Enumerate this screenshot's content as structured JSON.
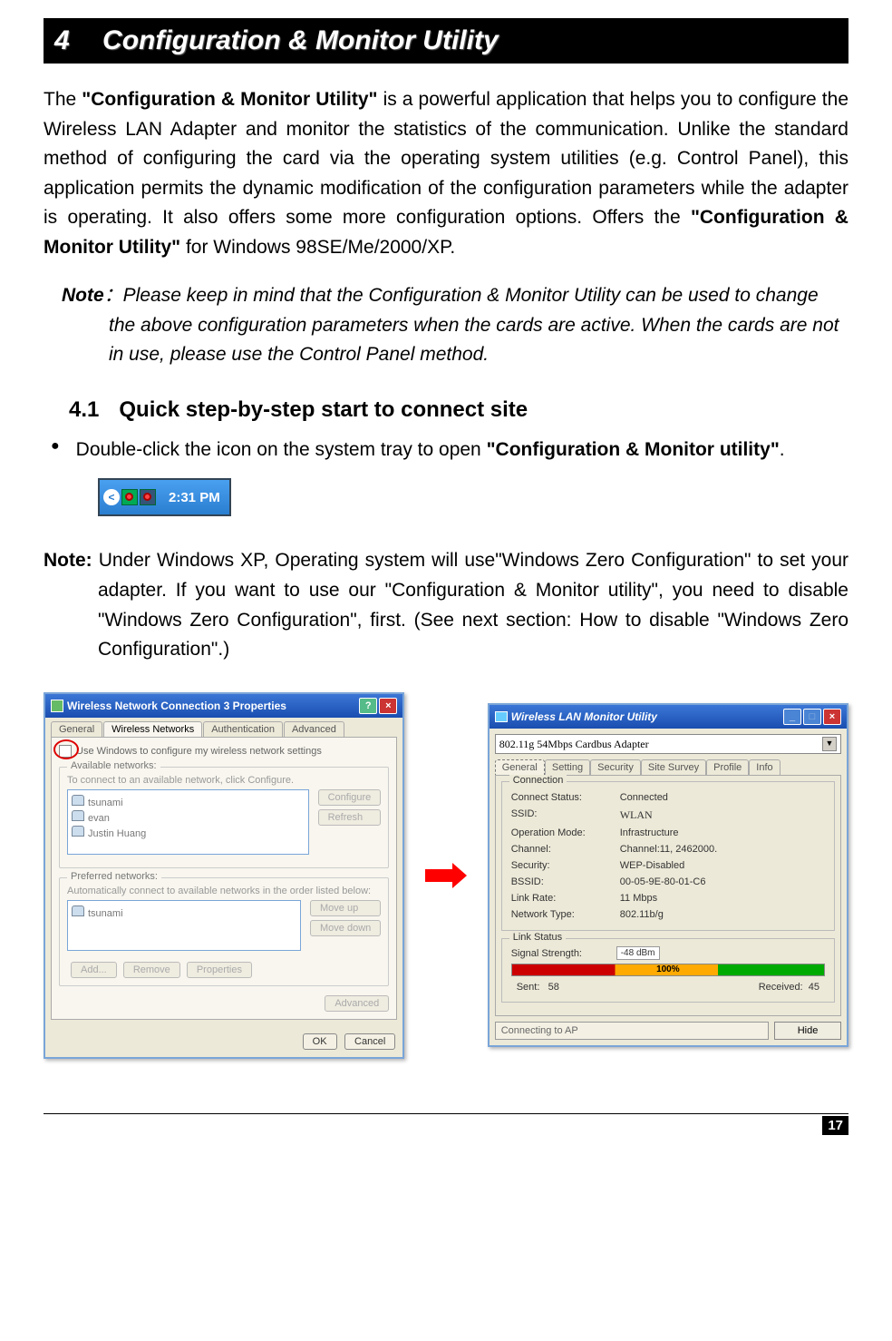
{
  "title": {
    "num": "4",
    "text": "Configuration & Monitor Utility"
  },
  "intro": {
    "pre": "The ",
    "b1": "\"Configuration & Monitor Utility\"",
    "mid1": " is a powerful application that helps you to configure the Wireless LAN Adapter and monitor the statistics of the communication. Unlike the standard method of configuring the card via the operating system utilities (e.g. Control Panel), this application permits the dynamic modification of the configuration parameters while the adapter is operating. It also offers some more configuration options. Offers the ",
    "b2": "\"Configuration & Monitor Utility\"",
    "mid2": " for Windows 98SE/Me/2000/XP."
  },
  "note1": {
    "label": "Note",
    "sep": "：",
    "text": "Please keep in mind that the Configuration & Monitor Utility can be used to change the above configuration parameters when the cards are active. When the cards are not in use, please use the Control Panel method."
  },
  "section": {
    "num": "4.1",
    "title": "Quick step-by-step start to connect site"
  },
  "bullet": {
    "pre": "Double-click the icon on the system tray to open ",
    "bold": "\"Configuration & Monitor utility\"",
    "post": "."
  },
  "tray_time": "2:31 PM",
  "note2": {
    "label": "Note:",
    "text": " Under Windows XP, Operating system will use\"Windows Zero Configuration\" to set your adapter. If you want to use our \"Configuration & Monitor utility\", you need to disable \"Windows Zero Configuration\", first. (See next section: How to disable \"Windows Zero Configuration\".)"
  },
  "props_window": {
    "title": "Wireless Network Connection 3 Properties",
    "tabs": [
      "General",
      "Wireless Networks",
      "Authentication",
      "Advanced"
    ],
    "active_tab": 1,
    "checkbox": "Use Windows to configure my wireless network settings",
    "available_label": "Available networks:",
    "available_hint": "To connect to an available network, click Configure.",
    "available_items": [
      "tsunami",
      "evan",
      "Justin Huang"
    ],
    "configure": "Configure",
    "refresh": "Refresh",
    "preferred_label": "Preferred networks:",
    "preferred_hint": "Automatically connect to available networks in the order listed below:",
    "preferred_items": [
      "tsunami"
    ],
    "moveup": "Move up",
    "movedown": "Move down",
    "add": "Add...",
    "remove": "Remove",
    "properties": "Properties",
    "advanced": "Advanced",
    "ok": "OK",
    "cancel": "Cancel"
  },
  "monitor_window": {
    "title": "Wireless LAN Monitor Utility",
    "adapter": "802.11g 54Mbps Cardbus Adapter",
    "tabs": [
      "General",
      "Setting",
      "Security",
      "Site Survey",
      "Profile",
      "Info"
    ],
    "active_tab": 0,
    "connection_label": "Connection",
    "fields": {
      "connect_status_k": "Connect Status:",
      "connect_status_v": "Connected",
      "ssid_k": "SSID:",
      "ssid_v": "WLAN",
      "opmode_k": "Operation Mode:",
      "opmode_v": "Infrastructure",
      "channel_k": "Channel:",
      "channel_v": "Channel:11, 2462000.",
      "security_k": "Security:",
      "security_v": "WEP-Disabled",
      "bssid_k": "BSSID:",
      "bssid_v": "00-05-9E-80-01-C6",
      "linkrate_k": "Link Rate:",
      "linkrate_v": "11 Mbps",
      "nettype_k": "Network Type:",
      "nettype_v": "802.11b/g"
    },
    "linkstatus_label": "Link Status",
    "signal_k": "Signal Strength:",
    "signal_v": "-48 dBm",
    "percent": "100%",
    "sent_k": "Sent:",
    "sent_v": "58",
    "recv_k": "Received:",
    "recv_v": "45",
    "status_text": "Connecting to AP",
    "hide": "Hide"
  },
  "page_number": "17"
}
